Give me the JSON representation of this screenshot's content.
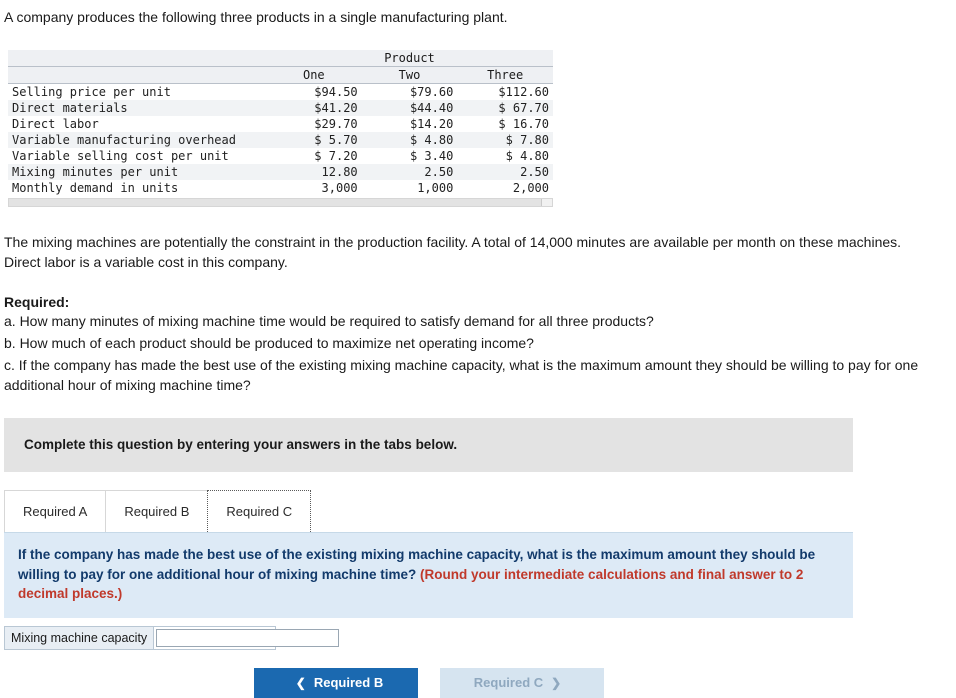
{
  "intro": "A company produces the following three products in a single manufacturing plant.",
  "table": {
    "group_header": "Product",
    "columns": [
      "One",
      "Two",
      "Three"
    ],
    "rows": [
      {
        "label": "Selling price per unit",
        "values": [
          "$94.50",
          "$79.60",
          "$112.60"
        ]
      },
      {
        "label": "Direct materials",
        "values": [
          "$41.20",
          "$44.40",
          "$ 67.70"
        ]
      },
      {
        "label": "Direct labor",
        "values": [
          "$29.70",
          "$14.20",
          "$ 16.70"
        ]
      },
      {
        "label": "Variable manufacturing overhead",
        "values": [
          "$ 5.70",
          "$ 4.80",
          "$  7.80"
        ]
      },
      {
        "label": "Variable selling cost per unit",
        "values": [
          "$ 7.20",
          "$ 3.40",
          "$  4.80"
        ]
      },
      {
        "label": "Mixing minutes per unit",
        "values": [
          "12.80",
          "2.50",
          "2.50"
        ]
      },
      {
        "label": "Monthly demand in units",
        "values": [
          "3,000",
          "1,000",
          "2,000"
        ]
      }
    ]
  },
  "paragraphs": {
    "constraint": "The mixing machines are potentially the constraint in the production facility. A total of 14,000 minutes are available per month on these machines.",
    "labor": "Direct labor is a variable cost in this company."
  },
  "required": {
    "heading": "Required:",
    "items": [
      "a. How many minutes of mixing machine time would be required to satisfy demand for all three products?",
      "b. How much of each product should be produced to maximize net operating income?",
      "c. If the company has made the best use of the existing mixing machine capacity, what is the maximum amount they should be willing to pay for one additional hour of mixing machine time?"
    ]
  },
  "instruction_bar": "Complete this question by entering your answers in the tabs below.",
  "tabs": [
    {
      "label": "Required A",
      "active": false
    },
    {
      "label": "Required B",
      "active": false
    },
    {
      "label": "Required C",
      "active": true
    }
  ],
  "question_panel": {
    "text": "If the company has made the best use of the existing mixing machine capacity, what is the maximum amount they should be willing to pay for one additional hour of mixing machine time?",
    "hint": "(Round your intermediate calculations and final answer to 2 decimal places.)"
  },
  "answer": {
    "label": "Mixing machine capacity",
    "value": "",
    "placeholder": ""
  },
  "nav": {
    "prev_label": "Required B",
    "prev_icon": "chevron-left-icon",
    "next_label": "Required C",
    "next_icon": "chevron-right-icon"
  },
  "colors": {
    "primary_button": "#1b69b0",
    "panel_blue": "#ddeaf6",
    "hint_red": "#c0392b",
    "grey_bar": "#e3e3e3"
  }
}
